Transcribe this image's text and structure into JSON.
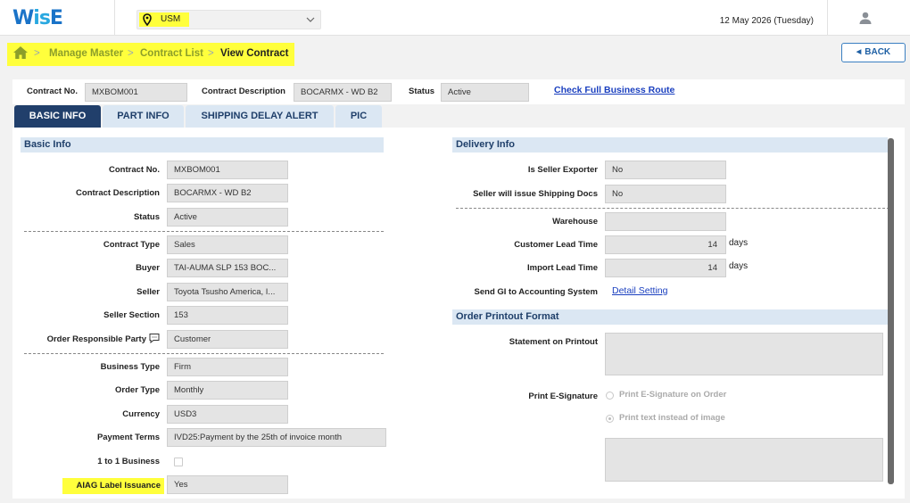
{
  "app": {
    "logo": "WisE",
    "logo_w": "W",
    "logo_is": "is",
    "logo_e": "E"
  },
  "header": {
    "site": "USM",
    "date": "12 May 2026 (Tuesday)",
    "icons": {
      "location": "location-pin-icon",
      "dropdown": "chevron-down-icon",
      "user": "user-icon"
    }
  },
  "breadcrumb": {
    "items": [
      "Manage Master",
      "Contract List",
      "View Contract"
    ],
    "home_icon": "home-icon",
    "separator": ">"
  },
  "back_button": {
    "label": "BACK"
  },
  "contract_header": {
    "contract_no_label": "Contract No.",
    "contract_no": "MXBOM001",
    "description_label": "Contract Description",
    "description": "BOCARMX - WD B2",
    "status_label": "Status",
    "status": "Active",
    "route_link": "Check Full Business Route"
  },
  "tabs": [
    {
      "label": "BASIC INFO",
      "active": true
    },
    {
      "label": "PART INFO",
      "active": false
    },
    {
      "label": "SHIPPING DELAY ALERT",
      "active": false
    },
    {
      "label": "PIC",
      "active": false
    }
  ],
  "basic_info": {
    "title": "Basic Info",
    "fields": [
      {
        "label": "Contract No.",
        "value": "MXBOM001"
      },
      {
        "label": "Contract Description",
        "value": "BOCARMX - WD B2"
      },
      {
        "label": "Status",
        "value": "Active"
      },
      {
        "label": "Contract Type",
        "value": "Sales"
      },
      {
        "label": "Buyer",
        "value": "TAI-AUMA SLP 153 BOC..."
      },
      {
        "label": "Seller",
        "value": "Toyota Tsusho America, I..."
      },
      {
        "label": "Seller Section",
        "value": "153"
      },
      {
        "label": "Order Responsible Party",
        "value": "Customer"
      },
      {
        "label": "Business Type",
        "value": "Firm"
      },
      {
        "label": "Order Type",
        "value": "Monthly"
      },
      {
        "label": "Currency",
        "value": "USD3"
      },
      {
        "label": "Payment Terms",
        "value": "IVD25:Payment by the 25th of invoice month"
      },
      {
        "label": "1 to 1 Business",
        "checked": false
      },
      {
        "label": "AIAG Label Issuance",
        "value": "Yes"
      }
    ],
    "comment_icon": "comment-icon"
  },
  "delivery_info": {
    "title": "Delivery Info",
    "fields": [
      {
        "label": "Is Seller Exporter",
        "value": "No"
      },
      {
        "label": "Seller will issue Shipping Docs",
        "value": "No"
      },
      {
        "label": "Warehouse",
        "value": ""
      },
      {
        "label": "Customer Lead Time",
        "value": "14",
        "unit": "days"
      },
      {
        "label": "Import Lead Time",
        "value": "14",
        "unit": "days"
      },
      {
        "label": "Send GI to Accounting System",
        "link": "Detail Setting"
      }
    ]
  },
  "order_printout": {
    "title": "Order Printout Format",
    "statement_label": "Statement on Printout",
    "statement_value": "",
    "signature_label": "Print E-Signature",
    "signature_options": [
      {
        "label": "Print E-Signature on Order",
        "selected": false
      },
      {
        "label": "Print text instead of image",
        "selected": true
      }
    ],
    "signature_text": ""
  },
  "colors": {
    "highlight": "#ffff3c",
    "tab_active": "#213f6b",
    "section_bg": "#dbe7f3",
    "link": "#1a3fbf",
    "breadcrumb": "#8c9e2a"
  }
}
